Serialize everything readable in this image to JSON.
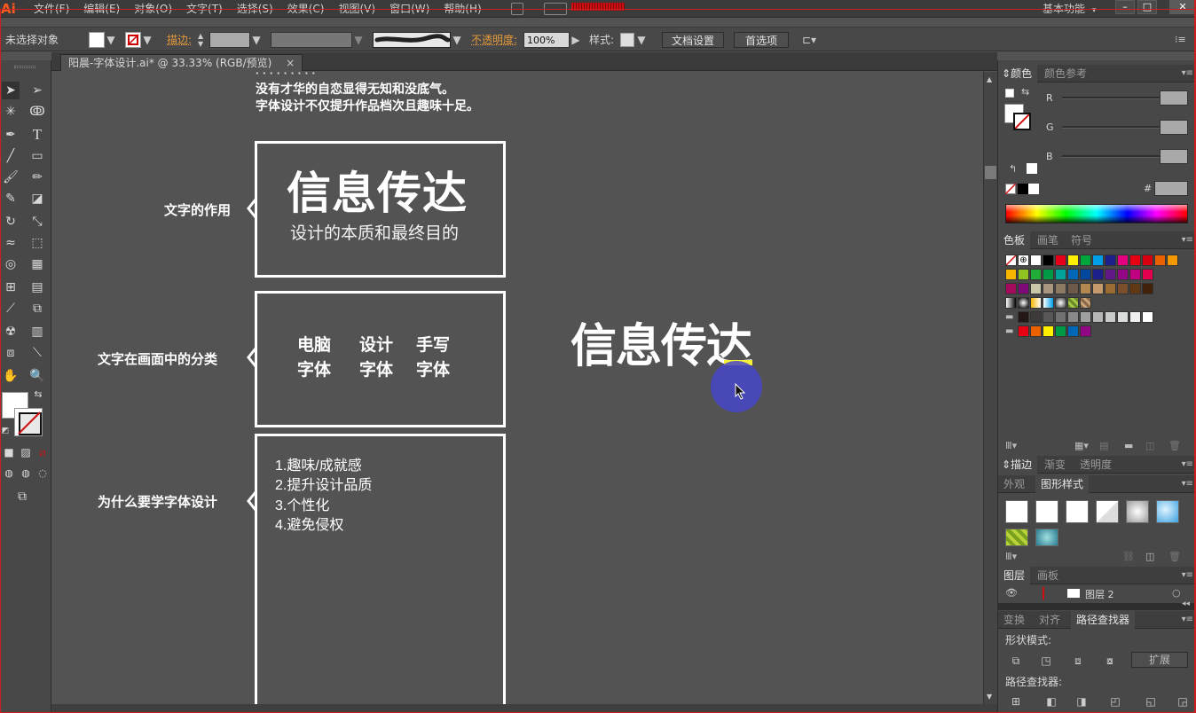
{
  "app": {
    "logo": "Ai"
  },
  "menu": [
    "文件(F)",
    "编辑(E)",
    "对象(O)",
    "文字(T)",
    "选择(S)",
    "效果(C)",
    "视图(V)",
    "窗口(W)",
    "帮助(H)"
  ],
  "workspace": {
    "label": "基本功能",
    "arrow": "▾"
  },
  "window_buttons": {
    "minimize": "–",
    "restore": "□",
    "close": "✕"
  },
  "control_bar": {
    "selection_status": "未选择对象",
    "stroke_label": "描边:",
    "opacity_label": "不透明度:",
    "opacity_value": "100%",
    "style_label": "样式:",
    "doc_setup": "文档设置",
    "preferences": "首选项"
  },
  "document_tab": {
    "title": "阳晨-字体设计.ai* @ 33.33% (RGB/预览)",
    "close": "×"
  },
  "canvas": {
    "intro_lines": [
      "没有才华的自恋显得无知和没底气。",
      "字体设计不仅提升作品档次且趣味十足。"
    ],
    "section1": {
      "label": "文字的作用",
      "big_title": "信息传达",
      "subtitle": "设计的本质和最终目的"
    },
    "section2": {
      "label": "文字在画面中的分类",
      "types_row1": [
        "电脑",
        "设计",
        "手写"
      ],
      "types_row2": [
        "字体",
        "字体",
        "字体"
      ]
    },
    "section3": {
      "label": "为什么要学字体设计",
      "reasons": [
        "1.趣味/成就感",
        "2.提升设计品质",
        "3.个性化",
        "4.避免侵权"
      ]
    },
    "floating_title": "信息传达"
  },
  "panels": {
    "color": {
      "tabs": [
        "颜色",
        "颜色参考"
      ],
      "channels": [
        "R",
        "G",
        "B"
      ],
      "hex_label": "#"
    },
    "swatches": {
      "tabs": [
        "色板",
        "画笔",
        "符号"
      ]
    },
    "stroke": {
      "tabs": [
        "描边",
        "渐变",
        "透明度"
      ]
    },
    "appearance": {
      "tabs": [
        "外观",
        "图形样式"
      ]
    },
    "layers": {
      "tabs": [
        "图层",
        "画板"
      ],
      "layer_name": "图层 2"
    },
    "pathfinder": {
      "tabs": [
        "变换",
        "对齐",
        "路径查找器"
      ],
      "shape_modes_label": "形状模式:",
      "expand": "扩展",
      "pathfinders_label": "路径查找器:"
    }
  },
  "colors": {
    "swatch_row1": [
      "#ffffff",
      "#000000",
      "#e6001a",
      "#fff100",
      "#00a53b",
      "#00a0e9",
      "#1d2088",
      "#e4007f",
      "#e60012",
      "#d7000f",
      "#eb6100",
      "#f39800"
    ],
    "swatch_row2": [
      "#f8b500",
      "#8fc31f",
      "#22ac38",
      "#009944",
      "#00a29a",
      "#0068b7",
      "#00479d",
      "#1d2088",
      "#601986",
      "#920783",
      "#be0081",
      "#e5004f"
    ],
    "swatch_row3": [
      "#a40b5d",
      "#7d0a78",
      "#c8c8a9",
      "#a89680",
      "#8c7a62",
      "#6d5a4a",
      "#b28850",
      "#c49a6c",
      "#996c33",
      "#7b4f2c",
      "#603813",
      "#42210b"
    ],
    "swatch_row5": [
      "#231815",
      "#3e3a39",
      "#595757",
      "#727171",
      "#898989",
      "#9fa0a0",
      "#b5b5b6",
      "#c9caca",
      "#dcdddd",
      "#efefef",
      "#ffffff"
    ],
    "swatch_row6": [
      "#e60012",
      "#eb6100",
      "#fff100",
      "#009944",
      "#0068b7",
      "#920783"
    ]
  }
}
